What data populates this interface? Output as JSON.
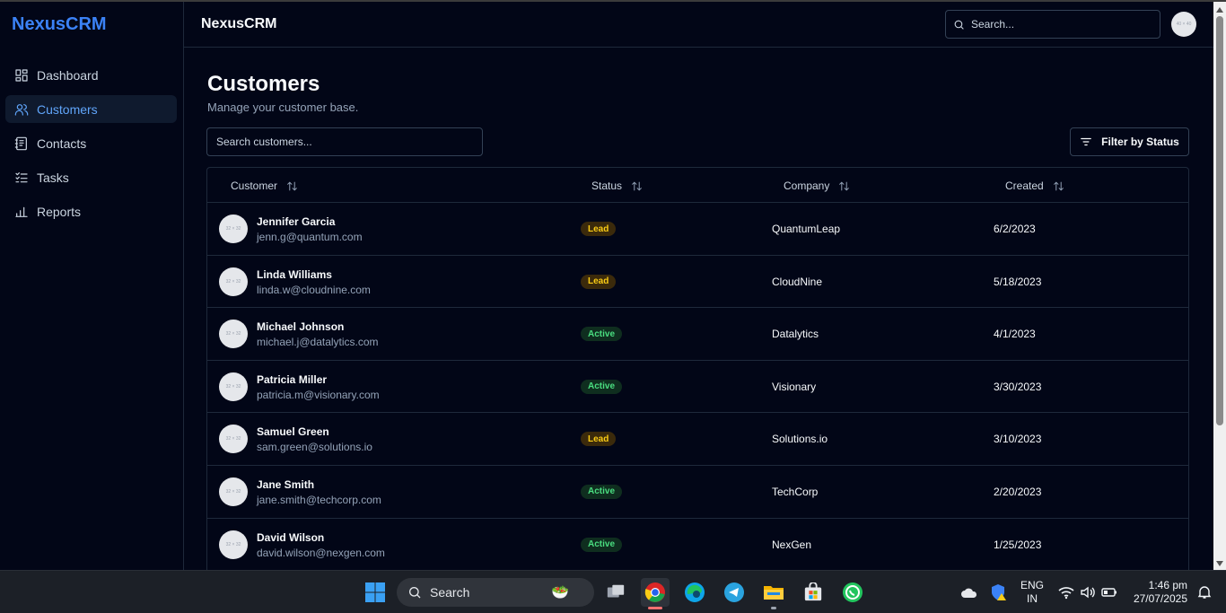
{
  "sidebar": {
    "brand": "NexusCRM",
    "items": [
      {
        "label": "Dashboard",
        "icon": "dashboard-icon",
        "active": false
      },
      {
        "label": "Customers",
        "icon": "users-icon",
        "active": true
      },
      {
        "label": "Contacts",
        "icon": "contacts-book-icon",
        "active": false
      },
      {
        "label": "Tasks",
        "icon": "tasks-list-icon",
        "active": false
      },
      {
        "label": "Reports",
        "icon": "bar-chart-icon",
        "active": false
      }
    ]
  },
  "header": {
    "title": "NexusCRM",
    "search_placeholder": "Search...",
    "avatar_text": "40 × 40"
  },
  "main": {
    "title": "Customers",
    "subtitle": "Manage your customer base.",
    "search_placeholder": "Search customers...",
    "filter_label": "Filter by Status"
  },
  "table": {
    "columns": [
      "Customer",
      "Status",
      "Company",
      "Created"
    ],
    "avatar_text": "32 × 32",
    "rows": [
      {
        "name": "Jennifer Garcia",
        "email": "jenn.g@quantum.com",
        "status": "Lead",
        "company": "QuantumLeap",
        "created": "6/2/2023"
      },
      {
        "name": "Linda Williams",
        "email": "linda.w@cloudnine.com",
        "status": "Lead",
        "company": "CloudNine",
        "created": "5/18/2023"
      },
      {
        "name": "Michael Johnson",
        "email": "michael.j@datalytics.com",
        "status": "Active",
        "company": "Datalytics",
        "created": "4/1/2023"
      },
      {
        "name": "Patricia Miller",
        "email": "patricia.m@visionary.com",
        "status": "Active",
        "company": "Visionary",
        "created": "3/30/2023"
      },
      {
        "name": "Samuel Green",
        "email": "sam.green@solutions.io",
        "status": "Lead",
        "company": "Solutions.io",
        "created": "3/10/2023"
      },
      {
        "name": "Jane Smith",
        "email": "jane.smith@techcorp.com",
        "status": "Active",
        "company": "TechCorp",
        "created": "2/20/2023"
      },
      {
        "name": "David Wilson",
        "email": "david.wilson@nexgen.com",
        "status": "Active",
        "company": "NexGen",
        "created": "1/25/2023"
      }
    ]
  },
  "taskbar": {
    "search_label": "Search",
    "lang_top": "ENG",
    "lang_bottom": "IN",
    "time": "1:46 pm",
    "date": "27/07/2025"
  },
  "colors": {
    "accent": "#3b82f6",
    "background": "#020617",
    "lead_badge": "#facc15",
    "active_badge": "#4ade80"
  }
}
